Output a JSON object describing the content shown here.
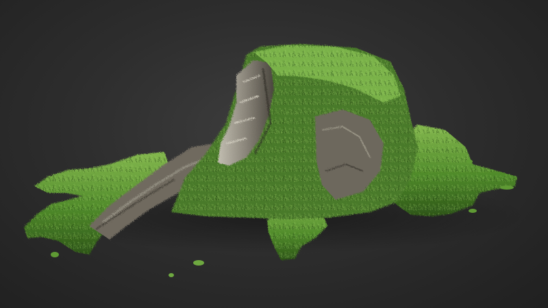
{
  "scene": {
    "subject": "mossy-tree-stump",
    "colors": {
      "background_center": "#3d3d3d",
      "background_edge": "#202020",
      "moss_light": "#7fb24a",
      "moss_mid": "#4f8a2a",
      "moss_dark": "#2f5a1a",
      "bark_light": "#b7b3a6",
      "bark_mid": "#7c786c",
      "bark_dark": "#3e3a33"
    }
  }
}
